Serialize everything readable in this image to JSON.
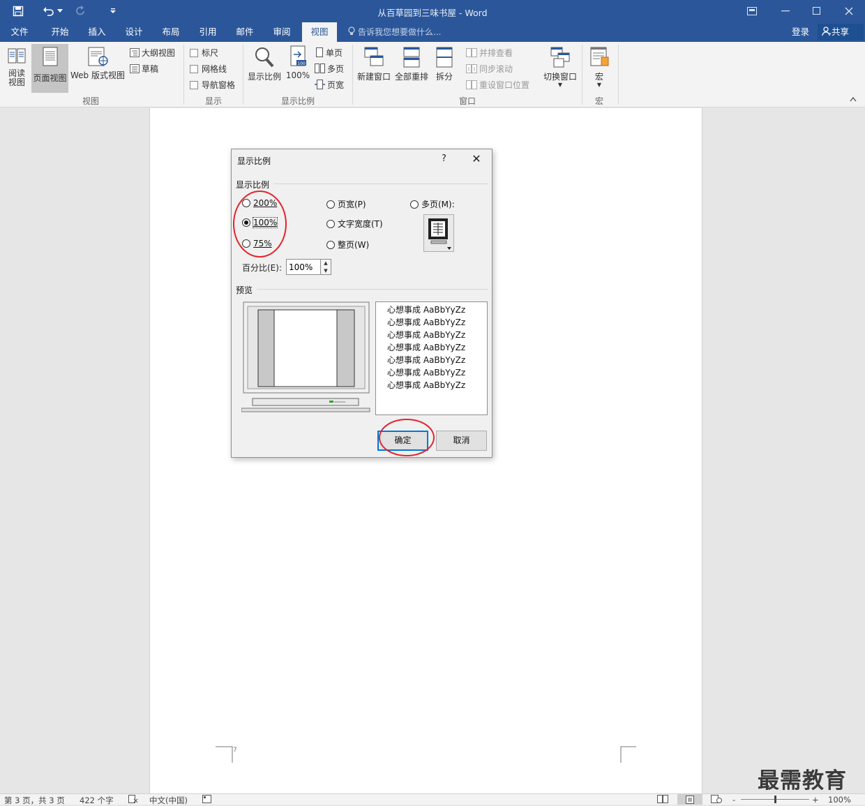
{
  "window": {
    "title": "从百草园到三味书屋 - Word"
  },
  "tabs": [
    "文件",
    "开始",
    "插入",
    "设计",
    "布局",
    "引用",
    "邮件",
    "审阅",
    "视图"
  ],
  "active_tab": "视图",
  "tell_me": "告诉我您想要做什么...",
  "account": {
    "login": "登录",
    "share": "共享"
  },
  "ribbon": {
    "view_group": {
      "label": "视图",
      "read_mode": "阅读\n视图",
      "print_layout": "页面视图",
      "web_layout": "Web 版式视图",
      "outline": "大纲视图",
      "draft": "草稿"
    },
    "show_group": {
      "label": "显示",
      "ruler": "标尺",
      "gridlines": "网格线",
      "nav_pane": "导航窗格"
    },
    "zoom_group": {
      "label": "显示比例",
      "zoom": "显示比例",
      "hundred": "100%",
      "one_page": "单页",
      "multi_page": "多页",
      "page_width": "页宽"
    },
    "window_group": {
      "label": "窗口",
      "new_window": "新建窗口",
      "arrange_all": "全部重排",
      "split": "拆分",
      "side_by_side": "并排查看",
      "sync_scroll": "同步滚动",
      "reset_pos": "重设窗口位置",
      "switch_window": "切换窗口"
    },
    "macro_group": {
      "label": "宏",
      "macros": "宏"
    }
  },
  "dialog": {
    "title": "显示比例",
    "help": "?",
    "close": "✕",
    "zoom_section": "显示比例",
    "r200": "200%",
    "r100": "100%",
    "r75": "75%",
    "page_width": "页宽(P)",
    "text_width": "文字宽度(T)",
    "whole_page": "整页(W)",
    "many_pages": "多页(M):",
    "percent_label": "百分比(E):",
    "percent_value": "100%",
    "preview_section": "预览",
    "preview_lines": [
      "心想事成 AaBbYyZz",
      "心想事成 AaBbYyZz",
      "心想事成 AaBbYyZz",
      "心想事成 AaBbYyZz",
      "心想事成 AaBbYyZz",
      "心想事成 AaBbYyZz",
      "心想事成 AaBbYyZz"
    ],
    "ok": "确定",
    "cancel": "取消",
    "selected": "100%"
  },
  "status": {
    "page": "第 3 页，共 3 页",
    "words": "422 个字",
    "lang": "中文(中国)",
    "zoom": "100%",
    "zoom_percent": 100
  },
  "watermark": "最需教育"
}
